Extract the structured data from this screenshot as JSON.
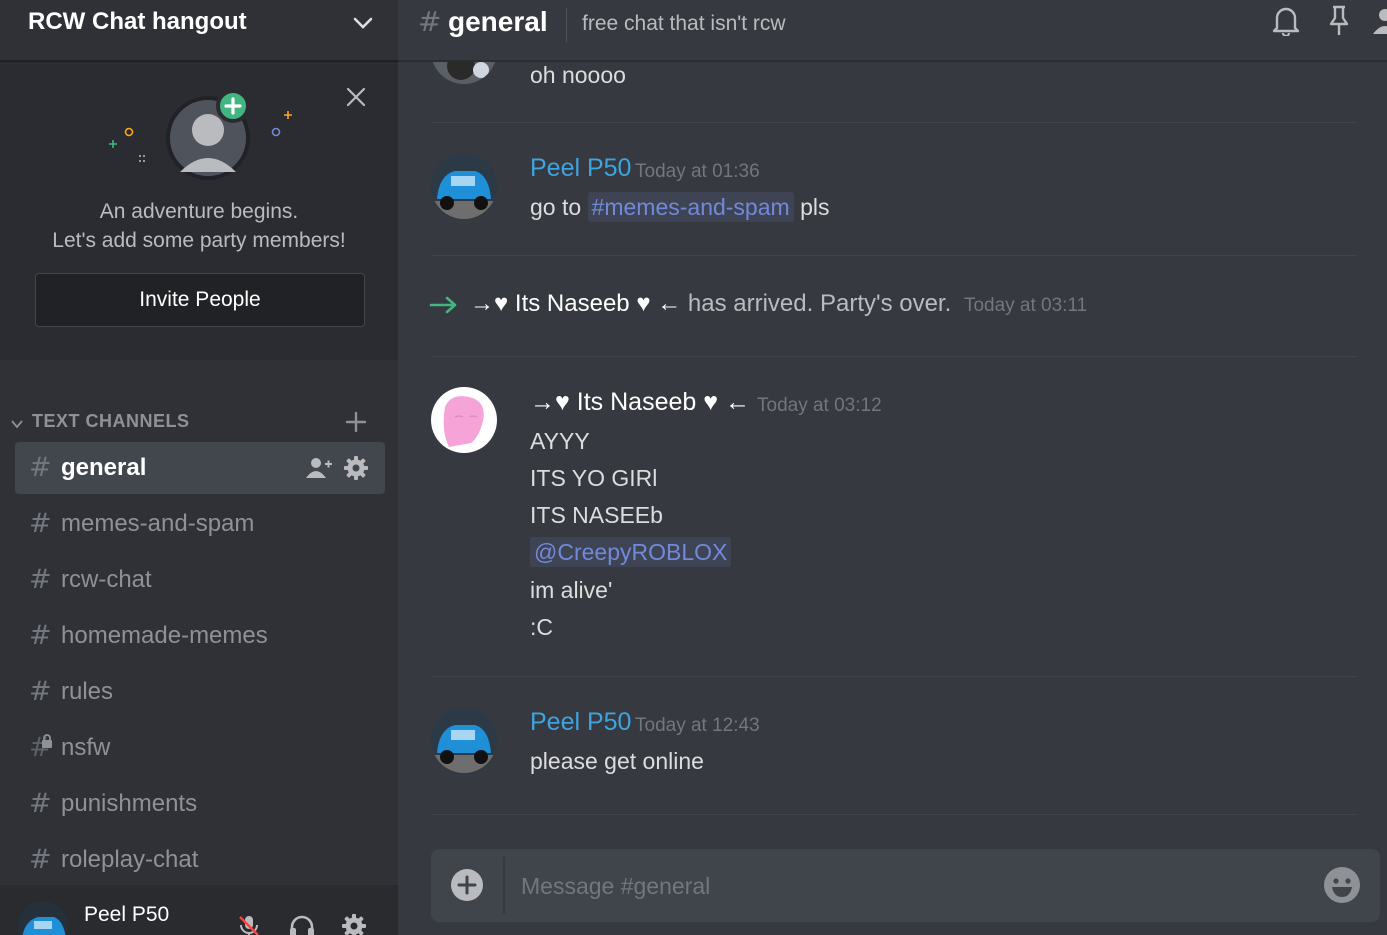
{
  "server": {
    "name": "RCW Chat hangout"
  },
  "invite": {
    "line1": "An adventure begins.",
    "line2": "Let's add some party members!",
    "button_label": "Invite People"
  },
  "category": {
    "label": "TEXT CHANNELS"
  },
  "channels": [
    {
      "hash": "#",
      "name": "general",
      "active": true
    },
    {
      "hash": "#",
      "name": "memes-and-spam"
    },
    {
      "hash": "#",
      "name": "rcw-chat"
    },
    {
      "hash": "#",
      "name": "homemade-memes"
    },
    {
      "hash": "#",
      "name": "rules"
    },
    {
      "hash": "#",
      "name": "nsfw",
      "locked": true
    },
    {
      "hash": "#",
      "name": "punishments"
    },
    {
      "hash": "#",
      "name": "roleplay-chat"
    }
  ],
  "user": {
    "name": "Peel P50"
  },
  "header": {
    "hash": "#",
    "title": "general",
    "topic": "free chat that isn't rcw"
  },
  "messages": {
    "m0": {
      "text": "oh noooo"
    },
    "m1": {
      "author": "Peel P50",
      "time": "Today at 01:36",
      "pre": "go to",
      "mention": "#memes-and-spam",
      "post": "pls"
    },
    "sys": {
      "name": "→♥ Its Naseeb ♥ ←",
      "text": "has arrived. Party's over.",
      "time": "Today at 03:11"
    },
    "m2": {
      "author": "→♥ Its Naseeb ♥ ←",
      "time": "Today at 03:12",
      "lines": [
        "AYYY",
        "ITS YO GIRl",
        "ITS NASEEb"
      ],
      "mention": "@CreepyROBLOX",
      "after": [
        "im alive'",
        ":C"
      ]
    },
    "m3": {
      "author": "Peel P50",
      "time": "Today at 12:43",
      "text": "please get online"
    }
  },
  "composer": {
    "placeholder": "Message #general"
  },
  "colors": {
    "background": "#36393f",
    "sidebar": "#2f3136",
    "peel_name": "#3ea4e0",
    "mention": "#7289da",
    "join_arrow": "#43b581",
    "invite_plus": "#43b581"
  }
}
